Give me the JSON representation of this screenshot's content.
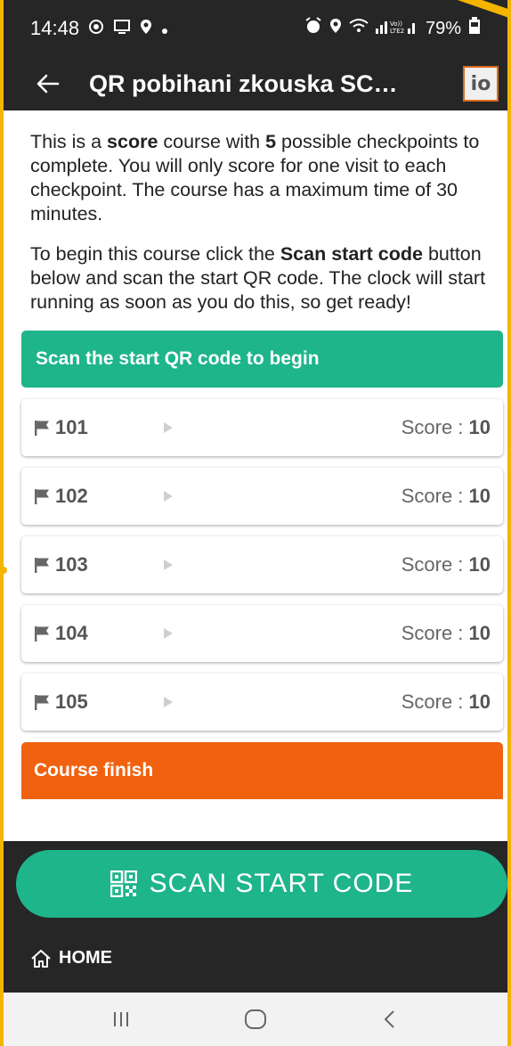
{
  "status": {
    "time": "14:48",
    "battery": "79%"
  },
  "toolbar": {
    "title": "QR pobihani zkouska SC…",
    "logo_text": "io"
  },
  "intro": {
    "p1": [
      {
        "t": "This is a ",
        "b": false
      },
      {
        "t": "score",
        "b": true
      },
      {
        "t": " course with ",
        "b": false
      },
      {
        "t": "5",
        "b": true
      },
      {
        "t": " possible checkpoints to complete. You will only score for one visit to each checkpoint. The course has a maximum time of 30 minutes.",
        "b": false
      }
    ],
    "p2": [
      {
        "t": "To begin this course click the ",
        "b": false
      },
      {
        "t": "Scan start code",
        "b": true
      },
      {
        "t": " button below and scan the start QR code. The clock will start running as soon as you do this, so get ready!",
        "b": false
      }
    ]
  },
  "start_bar": "Scan the start QR code to begin",
  "score_label": "Score : ",
  "checkpoints": [
    {
      "code": "101",
      "score": "10"
    },
    {
      "code": "102",
      "score": "10"
    },
    {
      "code": "103",
      "score": "10"
    },
    {
      "code": "104",
      "score": "10"
    },
    {
      "code": "105",
      "score": "10"
    }
  ],
  "finish_bar": "Course finish",
  "scan_button": "SCAN START CODE",
  "home": "HOME",
  "colors": {
    "accent_green": "#1eb58a",
    "finish_orange": "#f0620f",
    "dark_bar": "#262626"
  }
}
